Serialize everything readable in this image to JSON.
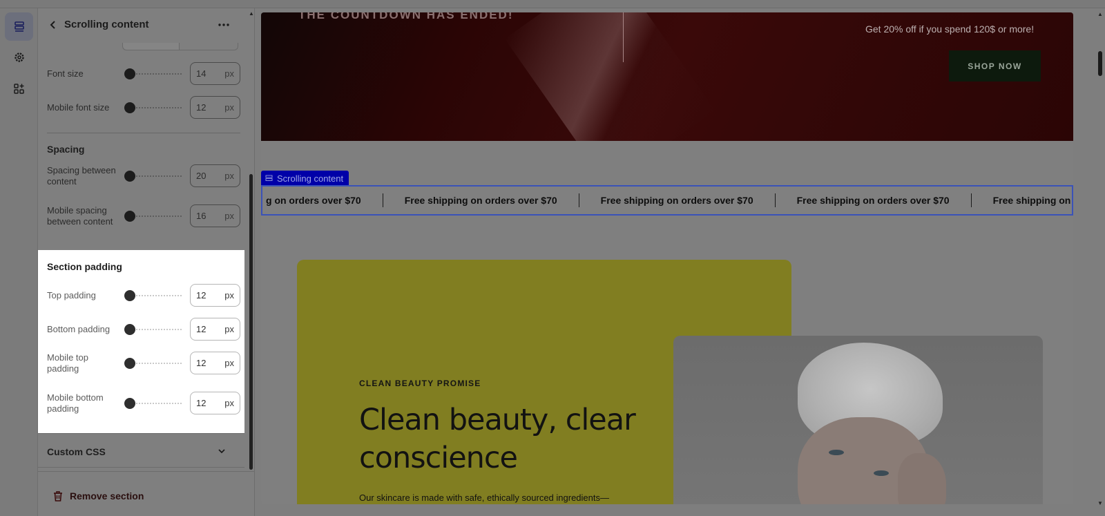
{
  "rail": {
    "items": [
      {
        "icon": "sections-icon",
        "active": true
      },
      {
        "icon": "gear-icon",
        "active": false
      },
      {
        "icon": "apps-add-icon",
        "active": false
      }
    ]
  },
  "panel": {
    "title": "Scrolling content",
    "rows_top": [
      {
        "label": "Font size",
        "value": "14",
        "unit": "px"
      },
      {
        "label": "Mobile font size",
        "value": "12",
        "unit": "px"
      }
    ],
    "spacing": {
      "heading": "Spacing",
      "rows": [
        {
          "label": "Spacing between content",
          "value": "20",
          "unit": "px"
        },
        {
          "label": "Mobile spacing between content",
          "value": "16",
          "unit": "px"
        }
      ]
    },
    "section_padding": {
      "heading": "Section padding",
      "rows": [
        {
          "label": "Top padding",
          "value": "12",
          "unit": "px"
        },
        {
          "label": "Bottom padding",
          "value": "12",
          "unit": "px"
        },
        {
          "label": "Mobile top padding",
          "value": "12",
          "unit": "px"
        },
        {
          "label": "Mobile bottom padding",
          "value": "12",
          "unit": "px"
        }
      ]
    },
    "custom_css": "Custom CSS",
    "remove_section": "Remove section"
  },
  "preview": {
    "hero": {
      "countdown": "THE COUNTDOWN HAS ENDED!",
      "offer": "Get 20% off if you spend 120$ or more!",
      "cta": "SHOP NOW"
    },
    "section_tag": "Scrolling content",
    "marquee": {
      "first_partial": "g on orders over $70",
      "items": [
        "Free shipping on orders over $70",
        "Free shipping on orders over $70",
        "Free shipping on orders over $70"
      ],
      "last_partial": "Free shipping on orders"
    },
    "promo": {
      "eyebrow": "CLEAN BEAUTY PROMISE",
      "title": "Clean beauty, clear conscience",
      "body": "Our skincare is made with safe, ethically sourced ingredients—"
    }
  }
}
